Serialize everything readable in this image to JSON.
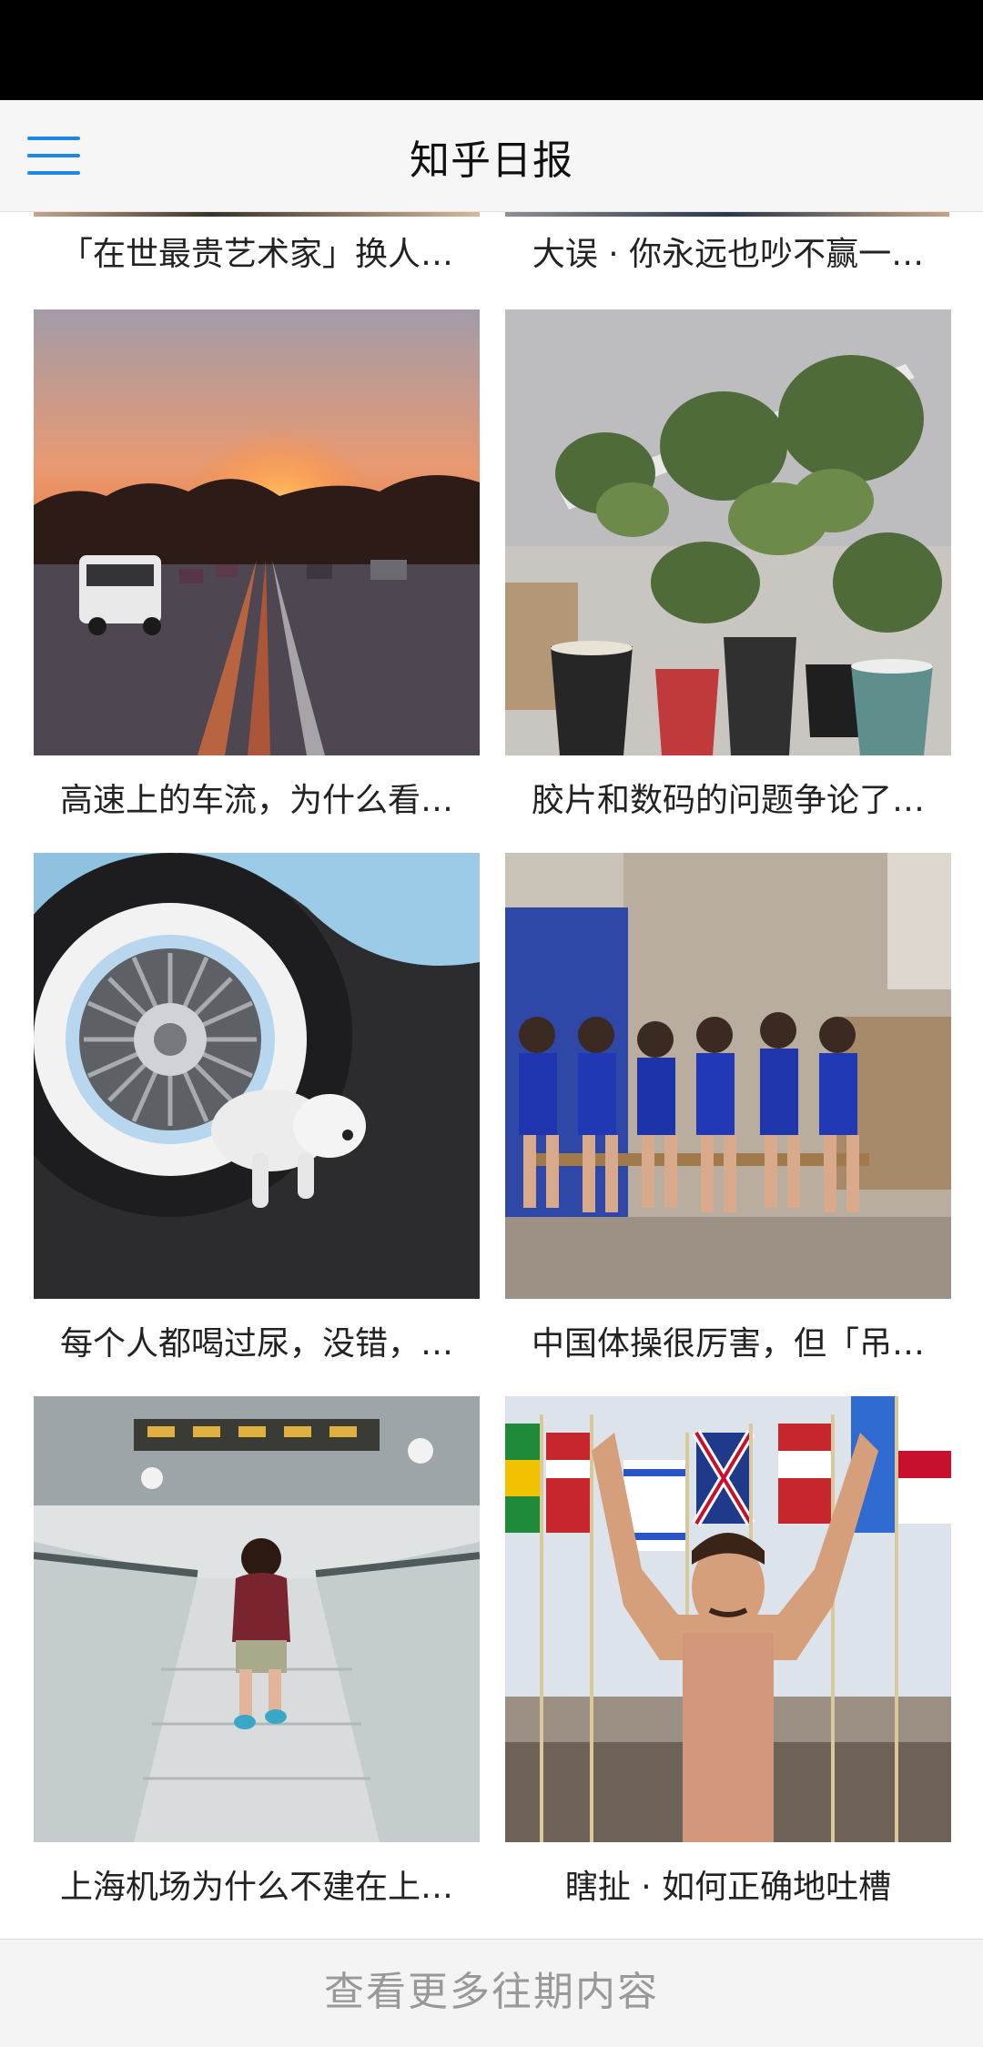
{
  "app": {
    "title": "知乎日报"
  },
  "top_row": [
    {
      "caption": "「在世最贵艺术家」换人…"
    },
    {
      "caption": "大误 · 你永远也吵不赢一…"
    }
  ],
  "stories": [
    {
      "caption": "高速上的车流，为什么看…",
      "image": "highway-sunset"
    },
    {
      "caption": "胶片和数码的问题争论了…",
      "image": "potted-plants"
    },
    {
      "caption": "每个人都喝过尿，没错，…",
      "image": "car-wheel-dog"
    },
    {
      "caption": "中国体操很厉害，但「吊…",
      "image": "young-gymnasts"
    },
    {
      "caption": "上海机场为什么不建在上…",
      "image": "airport-child"
    },
    {
      "caption": "瞎扯 · 如何正确地吐槽",
      "image": "swimmer-flags"
    }
  ],
  "footer": {
    "more_label": "查看更多往期内容"
  }
}
